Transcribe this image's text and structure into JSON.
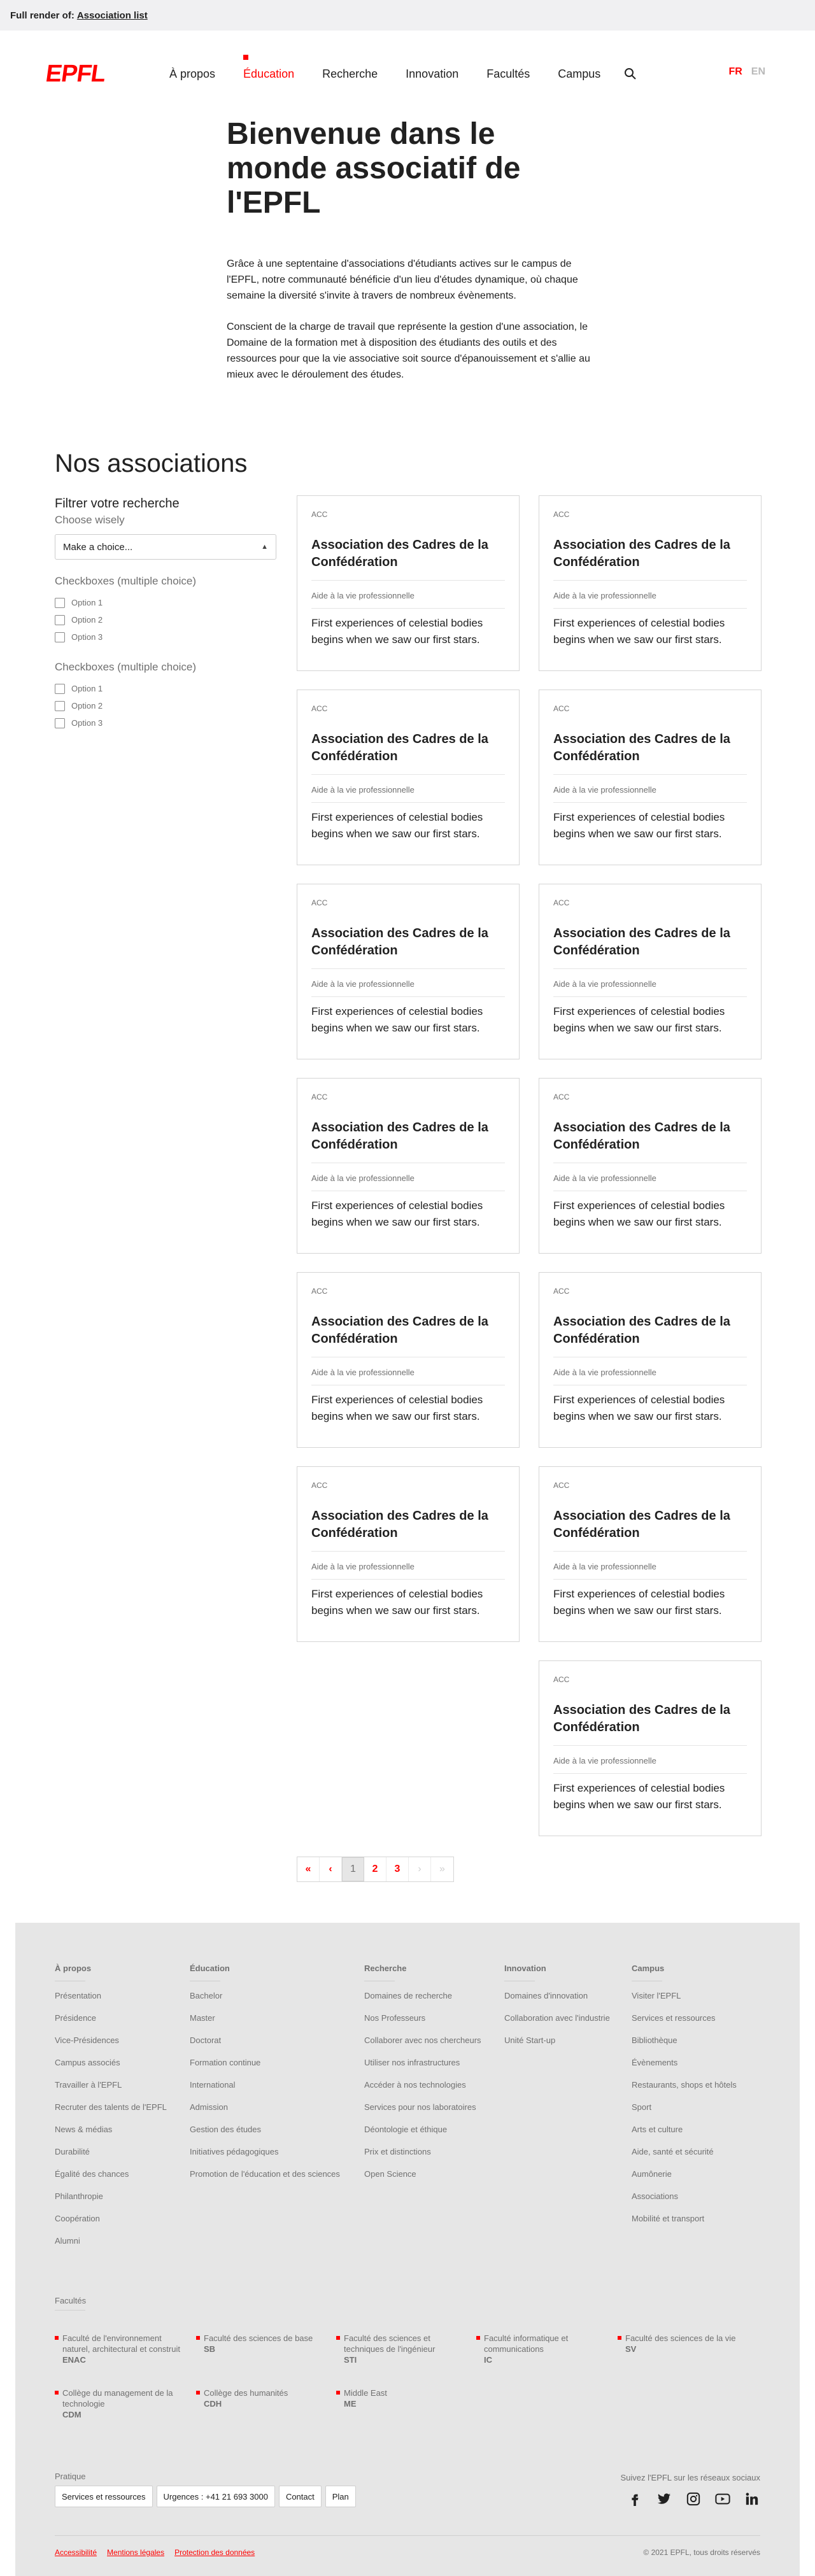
{
  "render_bar": {
    "prefix": "Full render of:",
    "link": "Association list"
  },
  "header": {
    "logo": "EPFL",
    "nav": [
      "À propos",
      "Éducation",
      "Recherche",
      "Innovation",
      "Facultés",
      "Campus"
    ],
    "active_nav": "Éducation",
    "lang": {
      "fr": "FR",
      "en": "EN",
      "active": "FR"
    }
  },
  "intro": {
    "title": "Bienvenue dans le monde associatif de l'EPFL",
    "p1": "Grâce à une septentaine d'associations d'étudiants actives sur le campus de l'EPFL, notre communauté bénéficie d'un lieu d'études dynamique, où chaque semaine la diversité s'invite à travers de nombreux évènements.",
    "p2": "Conscient de la charge de travail que représente la gestion d'une association, le Domaine de la formation met à disposition des étudiants des outils et des ressources pour que la vie associative soit source d'épanouissement et s'allie au mieux avec le déroulement des études."
  },
  "associations": {
    "title": "Nos associations",
    "filter": {
      "title": "Filtrer votre recherche",
      "subtitle": "Choose wisely",
      "select_value": "Make a choice...",
      "groups": [
        {
          "title": "Checkboxes (multiple choice)",
          "options": [
            "Option 1",
            "Option 2",
            "Option 3"
          ]
        },
        {
          "title": "Checkboxes (multiple choice)",
          "options": [
            "Option 1",
            "Option 2",
            "Option 3"
          ]
        }
      ]
    },
    "cards": [
      {
        "tag": "ACC",
        "title": "Association des Cadres de la Confédération",
        "category": "Aide à la vie professionnelle",
        "description": "First experiences of celestial bodies begins when we saw our first stars."
      },
      {
        "tag": "ACC",
        "title": "Association des Cadres de la Confédération",
        "category": "Aide à la vie professionnelle",
        "description": "First experiences of celestial bodies begins when we saw our first stars."
      },
      {
        "tag": "ACC",
        "title": "Association des Cadres de la Confédération",
        "category": "Aide à la vie professionnelle",
        "description": "First experiences of celestial bodies begins when we saw our first stars."
      },
      {
        "tag": "ACC",
        "title": "Association des Cadres de la Confédération",
        "category": "Aide à la vie professionnelle",
        "description": "First experiences of celestial bodies begins when we saw our first stars."
      },
      {
        "tag": "ACC",
        "title": "Association des Cadres de la Confédération",
        "category": "Aide à la vie professionnelle",
        "description": "First experiences of celestial bodies begins when we saw our first stars."
      },
      {
        "tag": "ACC",
        "title": "Association des Cadres de la Confédération",
        "category": "Aide à la vie professionnelle",
        "description": "First experiences of celestial bodies begins when we saw our first stars."
      },
      {
        "tag": "ACC",
        "title": "Association des Cadres de la Confédération",
        "category": "Aide à la vie professionnelle",
        "description": "First experiences of celestial bodies begins when we saw our first stars."
      },
      {
        "tag": "ACC",
        "title": "Association des Cadres de la Confédération",
        "category": "Aide à la vie professionnelle",
        "description": "First experiences of celestial bodies begins when we saw our first stars."
      },
      {
        "tag": "ACC",
        "title": "Association des Cadres de la Confédération",
        "category": "Aide à la vie professionnelle",
        "description": "First experiences of celestial bodies begins when we saw our first stars."
      },
      {
        "tag": "ACC",
        "title": "Association des Cadres de la Confédération",
        "category": "Aide à la vie professionnelle",
        "description": "First experiences of celestial bodies begins when we saw our first stars."
      },
      {
        "tag": "ACC",
        "title": "Association des Cadres de la Confédération",
        "category": "Aide à la vie professionnelle",
        "description": "First experiences of celestial bodies begins when we saw our first stars."
      },
      {
        "tag": "ACC",
        "title": "Association des Cadres de la Confédération",
        "category": "Aide à la vie professionnelle",
        "description": "First experiences of celestial bodies begins when we saw our first stars."
      },
      {
        "tag": "ACC",
        "title": "Association des Cadres de la Confédération",
        "category": "Aide à la vie professionnelle",
        "description": "First experiences of celestial bodies begins when we saw our first stars."
      }
    ],
    "pagination": {
      "first": "«",
      "prev": "‹",
      "pages": [
        "1",
        "2",
        "3"
      ],
      "current": "1",
      "next": "›",
      "last": "»"
    }
  },
  "footer": {
    "columns": [
      {
        "title": "À propos",
        "links": [
          "Présentation",
          "Présidence",
          "Vice-Présidences",
          "Campus associés",
          "Travailler à l'EPFL",
          "Recruter des talents de l'EPFL",
          "News & médias",
          "Durabilité",
          "Égalité des chances",
          "Philanthropie",
          "Coopération",
          "Alumni"
        ]
      },
      {
        "title": "Éducation",
        "links": [
          "Bachelor",
          "Master",
          "Doctorat",
          "Formation continue",
          "International",
          "Admission",
          "Gestion des études",
          "Initiatives pédagogiques",
          "Promotion de l'éducation et des sciences"
        ]
      },
      {
        "title": "Recherche",
        "links": [
          "Domaines de recherche",
          "Nos Professeurs",
          "Collaborer avec nos chercheurs",
          "Utiliser nos infrastructures",
          "Accéder à nos technologies",
          "Services pour nos laboratoires",
          "Déontologie et éthique",
          "Prix et distinctions",
          "Open Science"
        ]
      },
      {
        "title": "Innovation",
        "links": [
          "Domaines d'innovation",
          "Collaboration avec l'industrie",
          "Unité Start-up"
        ]
      },
      {
        "title": "Campus",
        "links": [
          "Visiter l'EPFL",
          "Services et ressources",
          "Bibliothèque",
          "Évènements",
          "Restaurants, shops et hôtels",
          "Sport",
          "Arts et culture",
          "Aide, santé et sécurité",
          "Aumônerie",
          "Associations",
          "Mobilité et transport"
        ]
      }
    ],
    "faculties_label": "Facultés",
    "faculties": [
      {
        "name": "Faculté de l'environnement naturel, architectural et construit",
        "code": "ENAC"
      },
      {
        "name": "Faculté des sciences de base",
        "code": "SB"
      },
      {
        "name": "Faculté des sciences et techniques de l'ingénieur",
        "code": "STI"
      },
      {
        "name": "Faculté informatique et communications",
        "code": "IC"
      },
      {
        "name": "Faculté des sciences de la vie",
        "code": "SV"
      },
      {
        "name": "Collège du management de la technologie",
        "code": "CDM"
      },
      {
        "name": "Collège des humanités",
        "code": "CDH"
      },
      {
        "name": "Middle East",
        "code": "ME"
      }
    ],
    "pratique_label": "Pratique",
    "pratique": [
      "Services et ressources",
      "Urgences : +41 21 693 3000",
      "Contact",
      "Plan"
    ],
    "social_label": "Suivez l'EPFL sur les réseaux sociaux",
    "social_icons": [
      "facebook-icon",
      "twitter-icon",
      "instagram-icon",
      "youtube-icon",
      "linkedin-icon"
    ],
    "legal": [
      "Accessibilité",
      "Mentions légales",
      "Protection des données"
    ],
    "copyright": "© 2021 EPFL, tous droits réservés"
  }
}
